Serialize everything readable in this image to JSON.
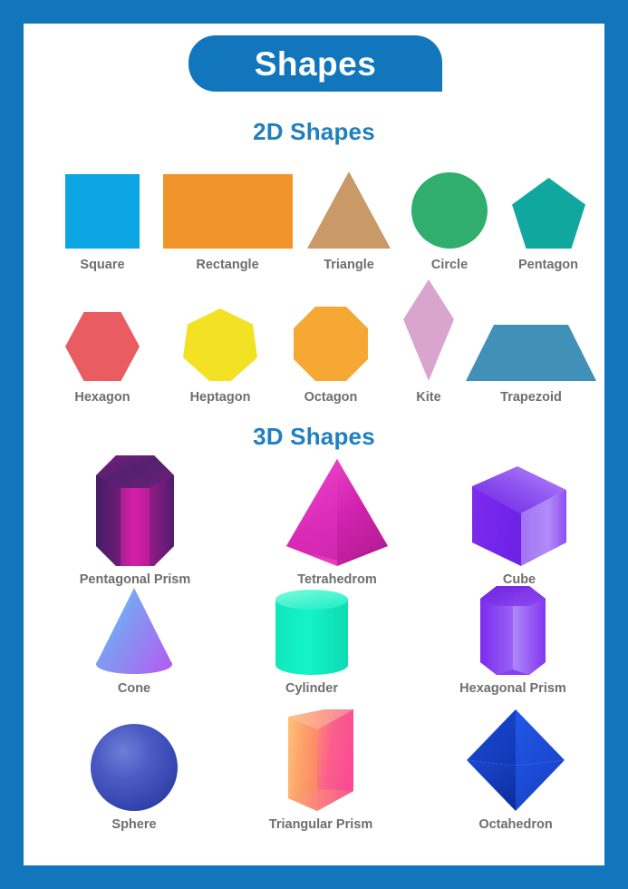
{
  "poster": {
    "title": "Shapes",
    "border_color": "#1176BC",
    "background_color": "#FFFFFF",
    "label_color": "#6E6E6E",
    "heading_color": "#1F7FBF"
  },
  "sections": [
    {
      "id": "2d",
      "heading": "2D Shapes",
      "rows": [
        {
          "items": [
            {
              "label": "Square",
              "color": "#0BA5E3",
              "icon": "square-shape"
            },
            {
              "label": "Rectangle",
              "color": "#F1952A",
              "icon": "rectangle-shape"
            },
            {
              "label": "Triangle",
              "color": "#C99A68",
              "icon": "triangle-shape"
            },
            {
              "label": "Circle",
              "color": "#2FAE6E",
              "icon": "circle-shape"
            },
            {
              "label": "Pentagon",
              "color": "#10A89E",
              "icon": "pentagon-shape"
            }
          ]
        },
        {
          "items": [
            {
              "label": "Hexagon",
              "color": "#E85C62",
              "icon": "hexagon-shape"
            },
            {
              "label": "Heptagon",
              "color": "#F3E124",
              "icon": "heptagon-shape"
            },
            {
              "label": "Octagon",
              "color": "#F5A833",
              "icon": "octagon-shape"
            },
            {
              "label": "Kite",
              "color": "#D9A5CF",
              "icon": "kite-shape"
            },
            {
              "label": "Trapezoid",
              "color": "#4090B8",
              "icon": "trapezoid-shape"
            }
          ]
        }
      ]
    },
    {
      "id": "3d",
      "heading": "3D Shapes",
      "rows": [
        {
          "items": [
            {
              "label": "Pentagonal Prism",
              "color": "#C4189C",
              "icon": "pentagonal-prism-shape"
            },
            {
              "label": "Tetrahedrom",
              "color": "#D81FB0",
              "icon": "tetrahedron-shape"
            },
            {
              "label": "Cube",
              "color": "#8434F2",
              "icon": "cube-shape"
            }
          ]
        },
        {
          "items": [
            {
              "label": "Cone",
              "color": "#7B86F5",
              "icon": "cone-shape"
            },
            {
              "label": "Cylinder",
              "color": "#17EFC0",
              "icon": "cylinder-shape"
            },
            {
              "label": "Hexagonal Prism",
              "color": "#8B3CF5",
              "icon": "hexagonal-prism-shape"
            }
          ]
        },
        {
          "items": [
            {
              "label": "Sphere",
              "color": "#3D50B5",
              "icon": "sphere-shape"
            },
            {
              "label": "Triangular Prism",
              "color": "#FC9C5A",
              "icon": "triangular-prism-shape"
            },
            {
              "label": "Octahedron",
              "color": "#1640C8",
              "icon": "octahedron-shape"
            }
          ]
        }
      ]
    }
  ]
}
